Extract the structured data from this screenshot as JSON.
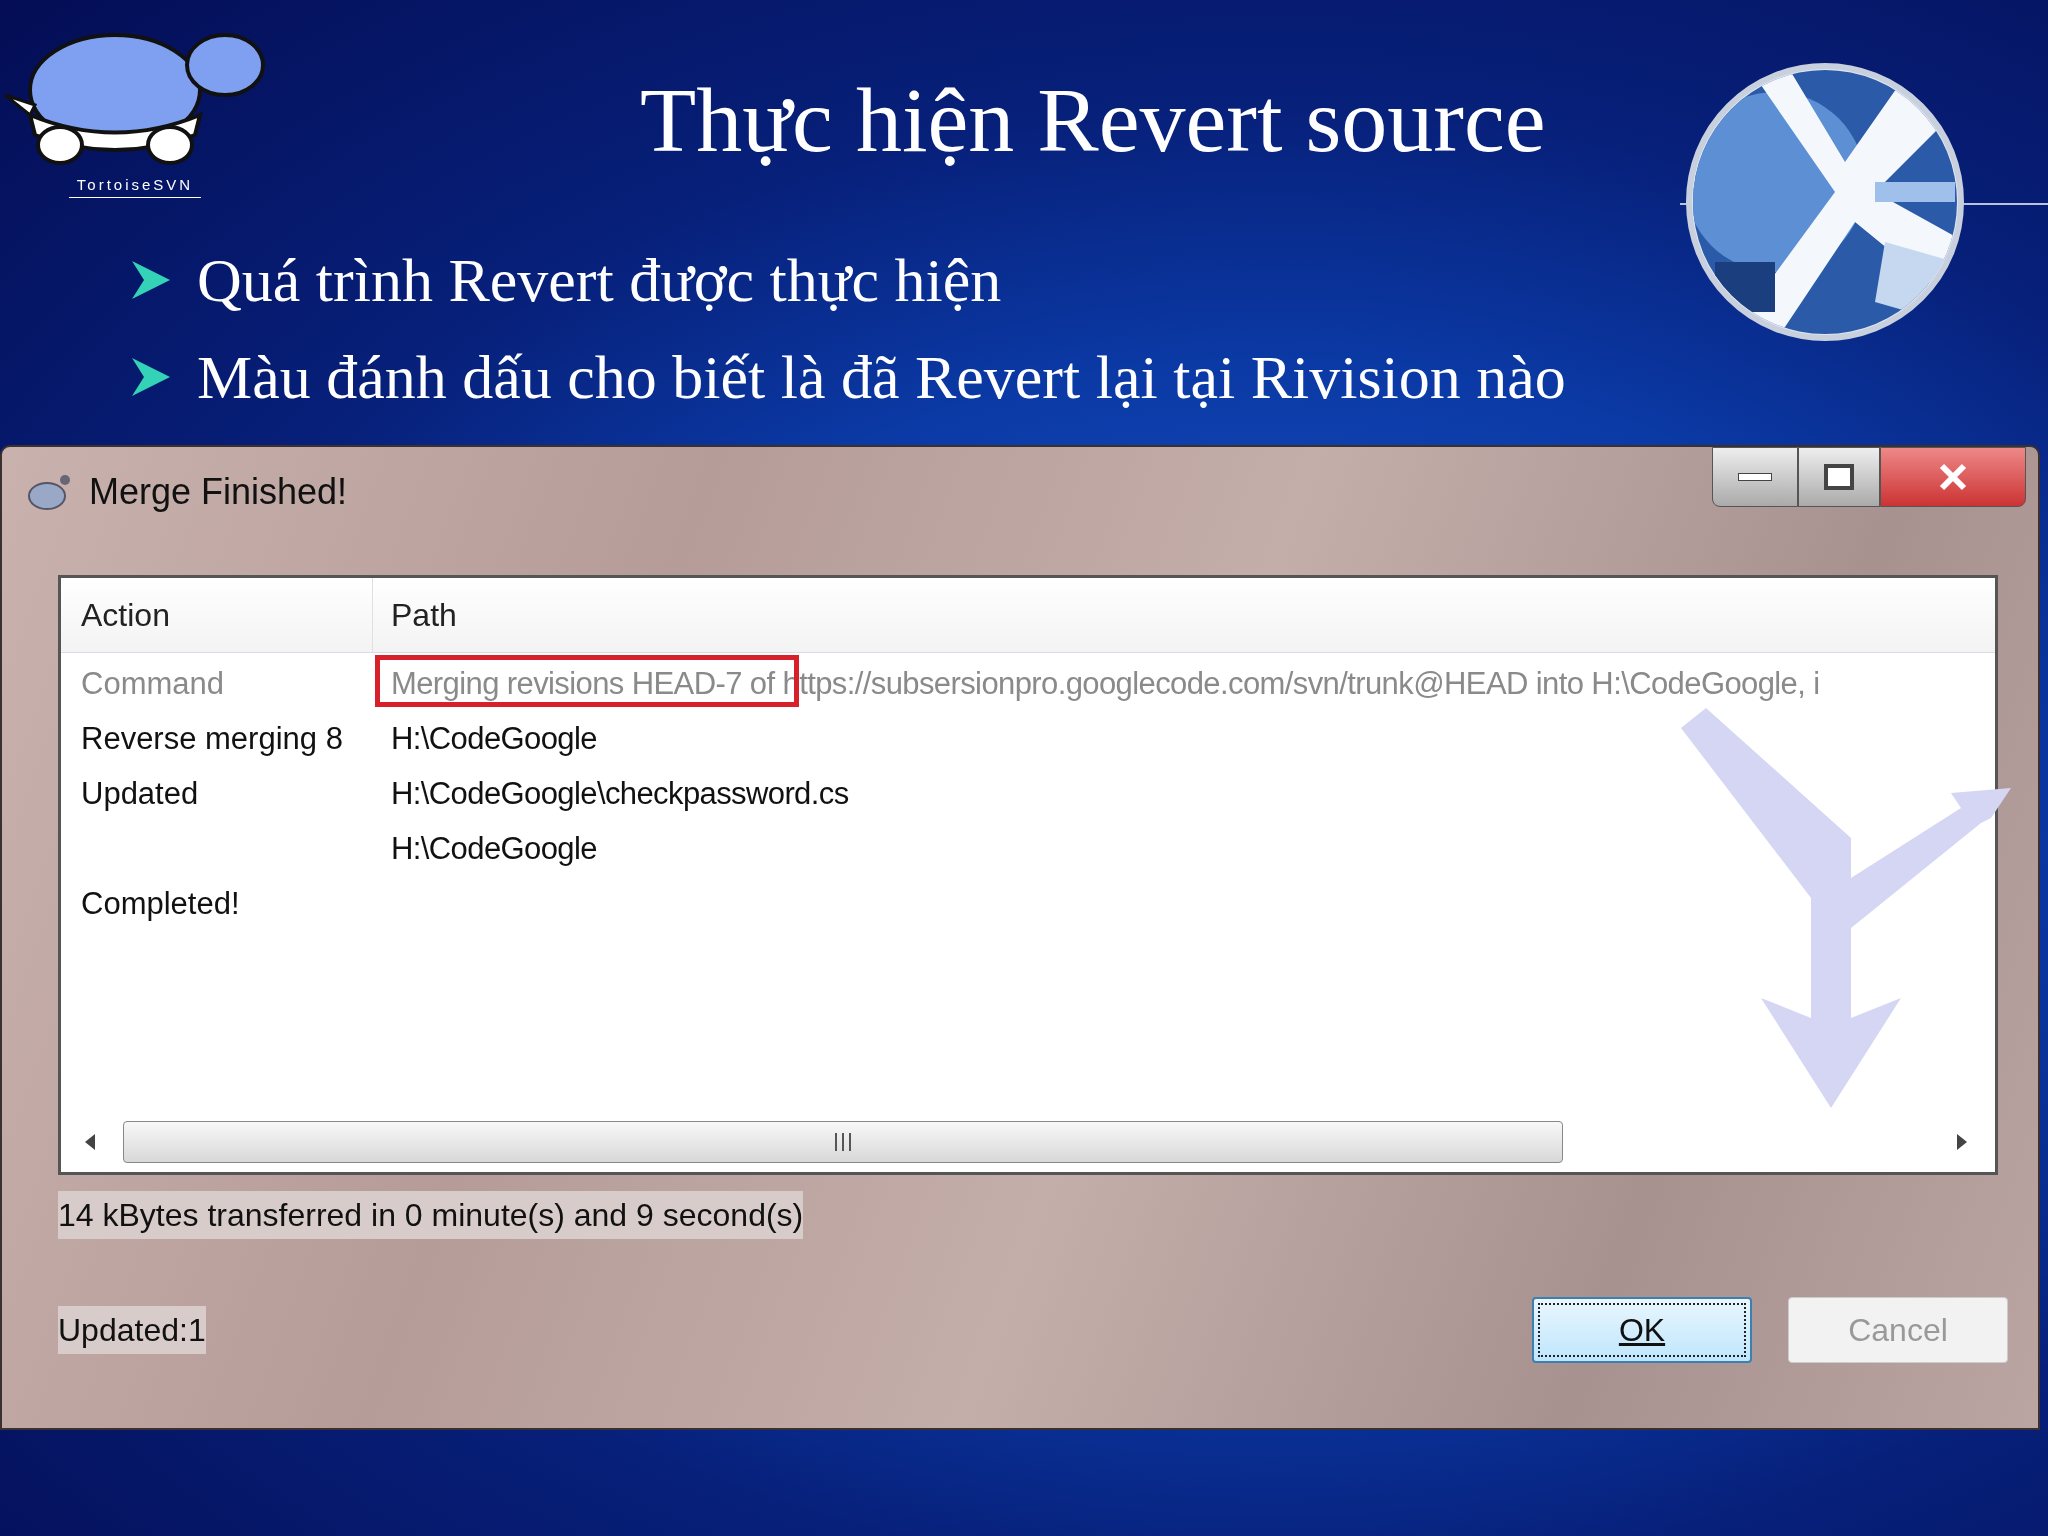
{
  "slide": {
    "logo_text": "TortoiseSVN",
    "title": "Thực hiện Revert source",
    "bullets": [
      "Quá trình Revert được thực hiện",
      "Màu đánh dấu cho biết là đã Revert lại tại Rivision nào"
    ]
  },
  "dialog": {
    "title": "Merge Finished!",
    "table": {
      "columns": [
        "Action",
        "Path"
      ],
      "rows": [
        {
          "action": "Command",
          "path": "Merging revisions HEAD-7 of https://subsersionpro.googlecode.com/svn/trunk@HEAD into H:\\CodeGoogle, i",
          "dimmed": true,
          "annotated": true
        },
        {
          "action": "Reverse merging 8",
          "path": "H:\\CodeGoogle",
          "dimmed": false,
          "annotated": false
        },
        {
          "action": "Updated",
          "path": "H:\\CodeGoogle\\checkpassword.cs",
          "dimmed": false,
          "annotated": false
        },
        {
          "path": "H:\\CodeGoogle",
          "dimmed": false,
          "annotated": false
        },
        {
          "action": "Completed!",
          "dimmed": false,
          "annotated": false
        }
      ]
    },
    "transfer_info": "14 kBytes transferred in 0 minute(s) and 9 second(s)",
    "summary": "Updated:1",
    "buttons": [
      {
        "label": "OK",
        "disabled": false
      },
      {
        "label": "Cancel",
        "disabled": true
      }
    ]
  }
}
